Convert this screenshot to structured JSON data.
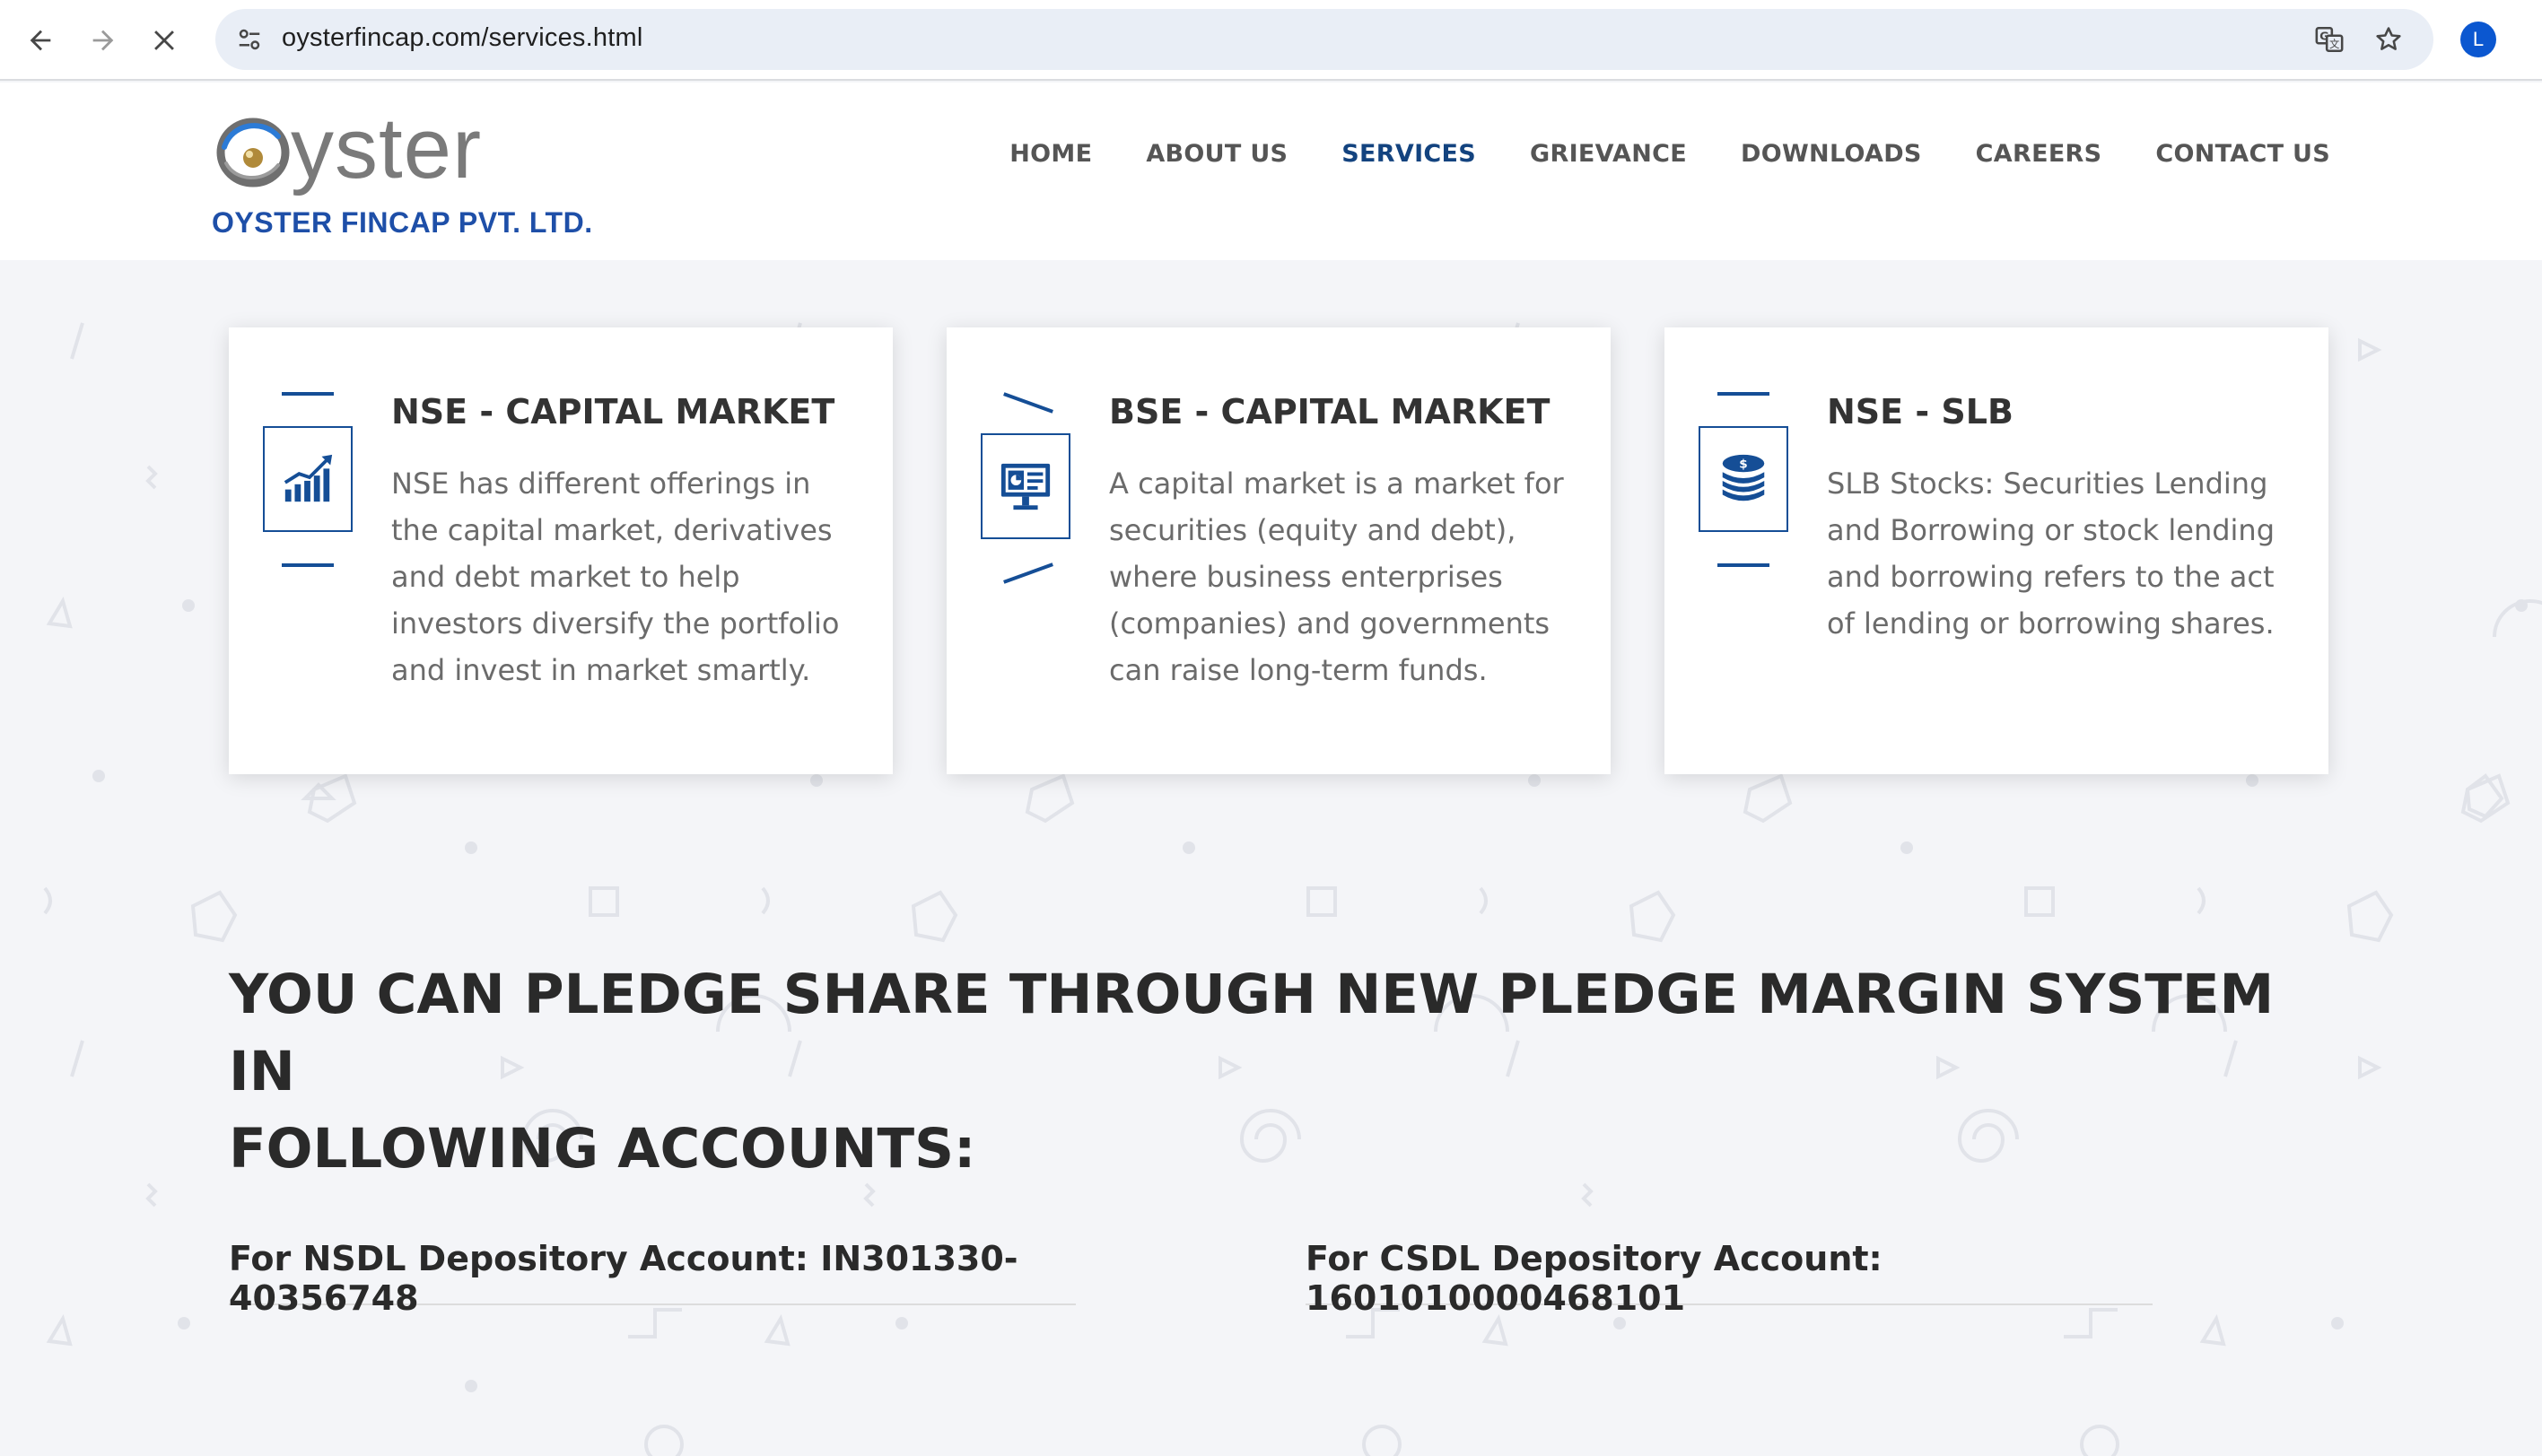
{
  "browser": {
    "url": "oysterfincap.com/services.html",
    "profile_initial": "L",
    "accent": "#0b57d0"
  },
  "site": {
    "logo_word": "yster",
    "company_name": "OYSTER FINCAP PVT. LTD.",
    "brand_color": "#154e96"
  },
  "nav": {
    "items": [
      {
        "label": "HOME"
      },
      {
        "label": "ABOUT US"
      },
      {
        "label": "SERVICES"
      },
      {
        "label": "GRIEVANCE"
      },
      {
        "label": "DOWNLOADS"
      },
      {
        "label": "CAREERS"
      },
      {
        "label": "CONTACT US"
      }
    ],
    "active": "SERVICES"
  },
  "cards": [
    {
      "title": "NSE - CAPITAL MARKET",
      "text": "NSE has different offerings in the capital market, derivatives and debt market to help investors diversify the portfolio and invest in market smartly.",
      "icon": "growth-chart-icon"
    },
    {
      "title": "BSE - CAPITAL MARKET",
      "text": "A capital market is a market for securities (equity and debt), where business enterprises (companies) and governments can raise long-term funds.",
      "icon": "presentation-monitor-icon"
    },
    {
      "title": "NSE - SLB",
      "text": "SLB Stocks: Securities Lending and Borrowing or stock lending and borrowing refers to the act of lending or borrowing shares.",
      "icon": "coin-stack-icon"
    }
  ],
  "pledge": {
    "heading_line1": "YOU CAN PLEDGE SHARE THROUGH NEW PLEDGE MARGIN SYSTEM IN",
    "heading_line2": "FOLLOWING ACCOUNTS:",
    "nsdl": "For NSDL Depository Account: IN301330-40356748",
    "cdsl": "For CSDL Depository Account: 1601010000468101"
  }
}
